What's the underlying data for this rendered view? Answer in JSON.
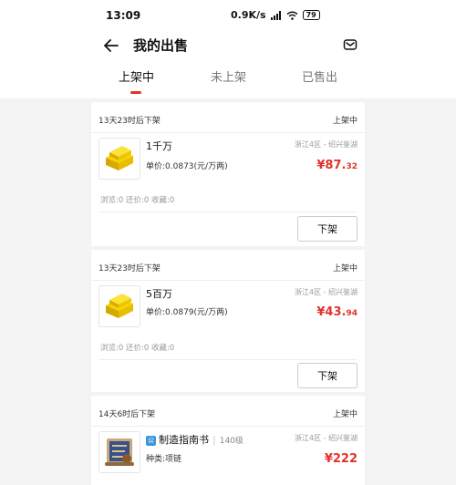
{
  "statusbar": {
    "time": "13:09",
    "speed": "0.9K/s",
    "battery": "79"
  },
  "header": {
    "title": "我的出售"
  },
  "tabs": [
    {
      "label": "上架中"
    },
    {
      "label": "未上架"
    },
    {
      "label": "已售出"
    }
  ],
  "listings": [
    {
      "time_left": "13天23时后下架",
      "status": "上架中",
      "name": "1千万",
      "unit_price": "单价:0.0873(元/万两)",
      "location": "浙江4区 - 绍兴鉴湖",
      "price_main": "¥87.",
      "price_cents": "32",
      "stats": "浏览:0  还价:0  收藏:0",
      "action": "下架",
      "icon": "gold-ingot-icon"
    },
    {
      "time_left": "13天23时后下架",
      "status": "上架中",
      "name": "5百万",
      "unit_price": "单价:0.0879(元/万两)",
      "location": "浙江4区 - 绍兴鉴湖",
      "price_main": "¥43.",
      "price_cents": "94",
      "stats": "浏览:0  还价:0  收藏:0",
      "action": "下架",
      "icon": "gold-ingot-icon"
    },
    {
      "time_left": "14天6时后下架",
      "status": "上架中",
      "badge": "公",
      "name": "制造指南书",
      "level": "140级",
      "category": "种类:项链",
      "location": "浙江4区 - 绍兴鉴湖",
      "price_main": "¥222",
      "icon": "guide-book-icon"
    }
  ],
  "colors": {
    "accent": "#e0342b",
    "badge": "#3c96e0"
  }
}
